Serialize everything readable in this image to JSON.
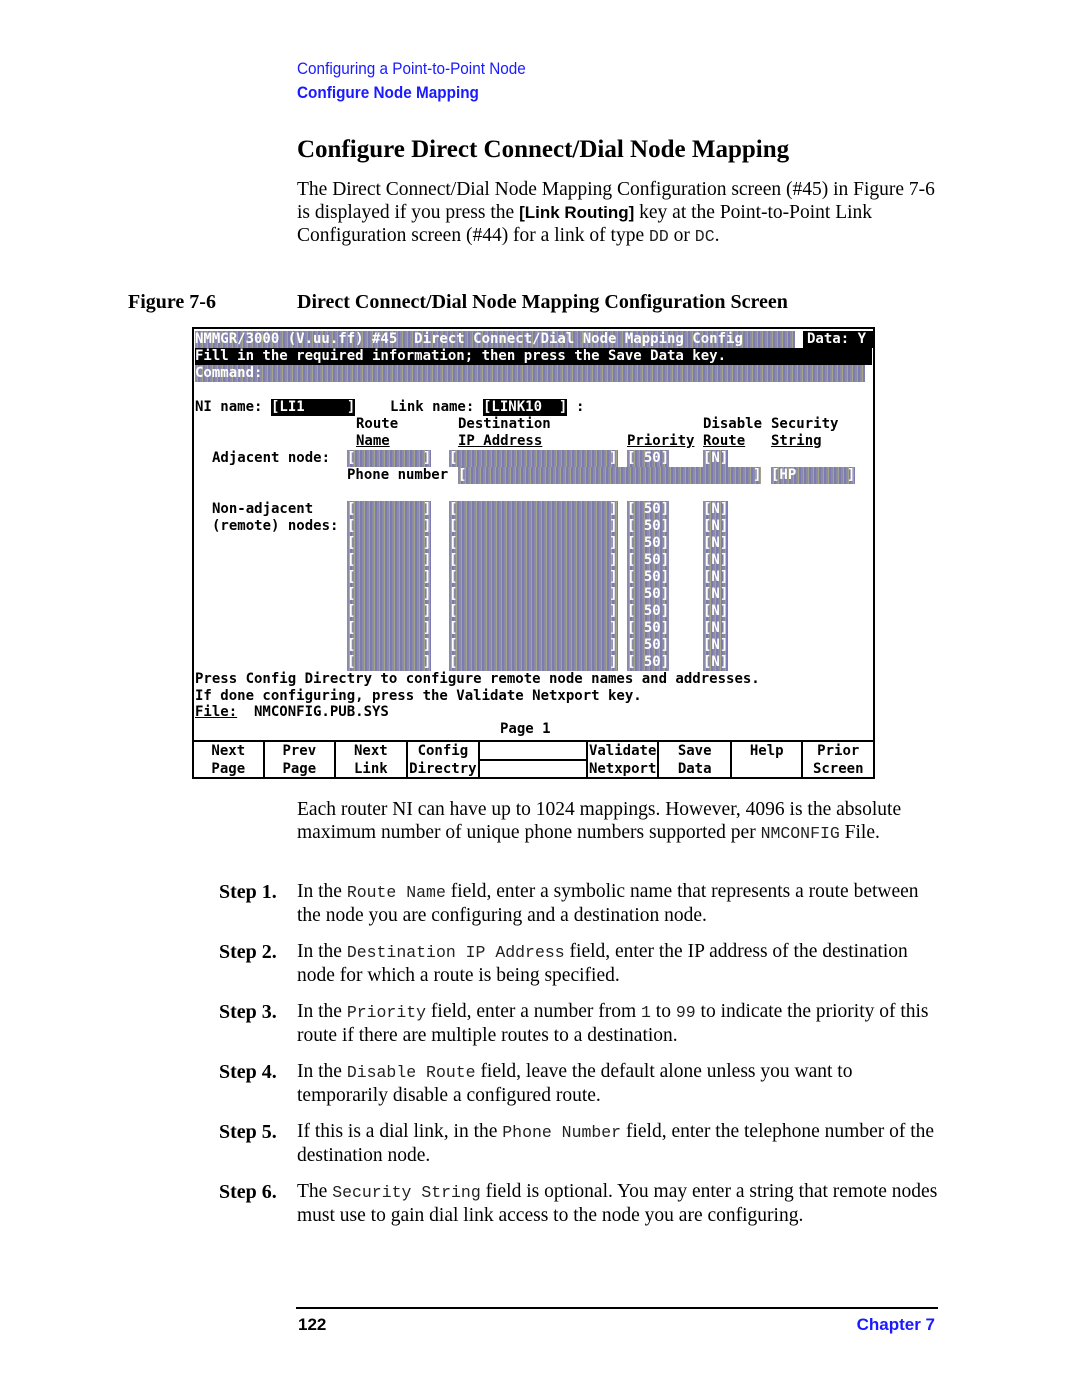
{
  "breadcrumb": {
    "parent": "Configuring a Point-to-Point Node",
    "current": "Configure Node Mapping"
  },
  "heading": "Configure Direct Connect/Dial Node Mapping",
  "intro": [
    {
      "t": "The Direct Connect/Dial Node Mapping Configuration screen (#45) in Figure 7-6 is displayed if you press the "
    },
    {
      "t": "[Link Routing]",
      "key": true
    },
    {
      "t": " key at the Point-to-Point Link Configuration screen (#44) for a link of type "
    },
    {
      "t": "DD",
      "code": true
    },
    {
      "t": " or "
    },
    {
      "t": "DC",
      "code": true
    },
    {
      "t": "."
    }
  ],
  "figure": {
    "label": "Figure 7-6",
    "title": "Direct Connect/Dial Node Mapping Configuration Screen"
  },
  "terminal": {
    "title": "NMMGR/3000 (V.uu.ff) #45  Direct Connect/Dial Node Mapping Config",
    "data_flag": "Data: Y",
    "message": "Fill in the required information; then press the Save Data key.",
    "command_label": "Command:",
    "ni_label": "NI name:",
    "ni_value": "[LI1     ]",
    "link_label": "Link name:",
    "link_value": "[LINK10  ]",
    "link_colon": ":",
    "headers": {
      "route_1": "Route",
      "route_2": "Name",
      "dest_1": "Destination",
      "dest_2": "IP Address",
      "priority": "Priority",
      "disable_1": "Disable",
      "disable_2": "Route",
      "security_1": "Security",
      "security_2": "String"
    },
    "adjacent_label": "Adjacent node:",
    "adjacent": {
      "route": "[        ]",
      "ip": "[                  ]",
      "priority": "[ 50]",
      "disable": "[N]"
    },
    "phone_label": "Phone number",
    "phone_value": "[                                  ]",
    "security_value": "[HP      ]",
    "nonadjacent_label_1": "Non-adjacent",
    "nonadjacent_label_2": "(remote) nodes:",
    "remote_rows": [
      {
        "route": "[        ]",
        "ip": "[                  ]",
        "priority": "[ 50]",
        "disable": "[N]"
      },
      {
        "route": "[        ]",
        "ip": "[                  ]",
        "priority": "[ 50]",
        "disable": "[N]"
      },
      {
        "route": "[        ]",
        "ip": "[                  ]",
        "priority": "[ 50]",
        "disable": "[N]"
      },
      {
        "route": "[        ]",
        "ip": "[                  ]",
        "priority": "[ 50]",
        "disable": "[N]"
      },
      {
        "route": "[        ]",
        "ip": "[                  ]",
        "priority": "[ 50]",
        "disable": "[N]"
      },
      {
        "route": "[        ]",
        "ip": "[                  ]",
        "priority": "[ 50]",
        "disable": "[N]"
      },
      {
        "route": "[        ]",
        "ip": "[                  ]",
        "priority": "[ 50]",
        "disable": "[N]"
      },
      {
        "route": "[        ]",
        "ip": "[                  ]",
        "priority": "[ 50]",
        "disable": "[N]"
      },
      {
        "route": "[        ]",
        "ip": "[                  ]",
        "priority": "[ 50]",
        "disable": "[N]"
      },
      {
        "route": "[        ]",
        "ip": "[                  ]",
        "priority": "[ 50]",
        "disable": "[N]"
      }
    ],
    "note_1": "Press Config Directry to configure remote node names and addresses.",
    "note_2": "If done configuring, press the Validate Netxport key.",
    "file_label": "File:",
    "file_value": "NMCONFIG.PUB.SYS",
    "page_label": "Page 1",
    "function_keys": [
      {
        "label": "Next\nPage"
      },
      {
        "label": "Prev\nPage"
      },
      {
        "label": "Next\nLink"
      },
      {
        "label": "Config\nDirectry"
      },
      {
        "label": ""
      },
      {
        "label": "Validate\nNetxport"
      },
      {
        "label": "Save\nData"
      },
      {
        "label": "Help"
      },
      {
        "label": "Prior\nScreen"
      }
    ]
  },
  "after_figure": [
    {
      "t": "Each router NI can have up to 1024 mappings. However, 4096 is the absolute maximum number of unique phone numbers supported per "
    },
    {
      "t": "NMCONFIG",
      "code": true
    },
    {
      "t": " File."
    }
  ],
  "steps": [
    {
      "label": "Step 1.",
      "parts": [
        {
          "t": "In the "
        },
        {
          "t": "Route Name",
          "code": true
        },
        {
          "t": " field, enter a symbolic name that represents a route between the node you are configuring and a destination node."
        }
      ]
    },
    {
      "label": "Step 2.",
      "parts": [
        {
          "t": "In the "
        },
        {
          "t": "Destination IP Address",
          "code": true
        },
        {
          "t": "  field, enter the IP address of the destination node for which a route is being specified."
        }
      ]
    },
    {
      "label": "Step 3.",
      "parts": [
        {
          "t": "In the "
        },
        {
          "t": "Priority",
          "code": true
        },
        {
          "t": " field, enter a number from "
        },
        {
          "t": "1",
          "code": true
        },
        {
          "t": " to "
        },
        {
          "t": "99",
          "code": true
        },
        {
          "t": " to indicate the priority of this route if there are multiple routes to a destination."
        }
      ]
    },
    {
      "label": "Step 4.",
      "parts": [
        {
          "t": "In the "
        },
        {
          "t": "Disable Route",
          "code": true
        },
        {
          "t": " field, leave the default alone unless you want to temporarily disable a configured route."
        }
      ]
    },
    {
      "label": "Step 5.",
      "parts": [
        {
          "t": "If this is a dial link, in the "
        },
        {
          "t": "Phone Number",
          "code": true
        },
        {
          "t": " field, enter the telephone number of the destination node."
        }
      ]
    },
    {
      "label": "Step 6.",
      "parts": [
        {
          "t": "The "
        },
        {
          "t": "Security String",
          "code": true
        },
        {
          "t": " field is optional. You may enter a string that remote nodes must use to gain dial link access to the node you are configuring."
        }
      ]
    }
  ],
  "footer": {
    "page_number": "122",
    "chapter": "Chapter 7"
  },
  "colors": {
    "link_blue": "#1a1aff",
    "terminal_inverse": "#000000",
    "field_fill": "#8c8ca8"
  }
}
